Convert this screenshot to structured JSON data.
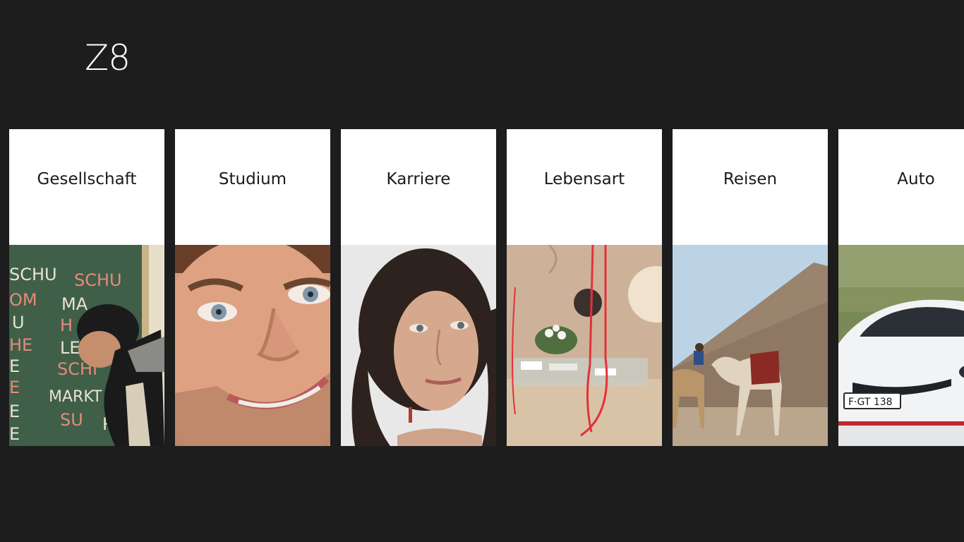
{
  "app": {
    "title": "Z8"
  },
  "categories": [
    {
      "label": "Gesellschaft",
      "image": "classroom-chalkboard-photo"
    },
    {
      "label": "Studium",
      "image": "smiling-man-face-photo"
    },
    {
      "label": "Karriere",
      "image": "woman-portrait-photo"
    },
    {
      "label": "Lebensart",
      "image": "interior-table-ribbons-photo"
    },
    {
      "label": "Reisen",
      "image": "pyramid-camels-photo"
    },
    {
      "label": "Auto",
      "image": "white-car-photo"
    }
  ],
  "photo_text": {
    "chalkboard_words": [
      "SCHU",
      "SCHU",
      "OM",
      "MA",
      "U",
      "H",
      "HE",
      "LE",
      "E",
      "SCHI",
      "E",
      "MARKT",
      "E",
      "SU",
      "RE",
      "E"
    ],
    "license_plate": "F·GT 138"
  }
}
